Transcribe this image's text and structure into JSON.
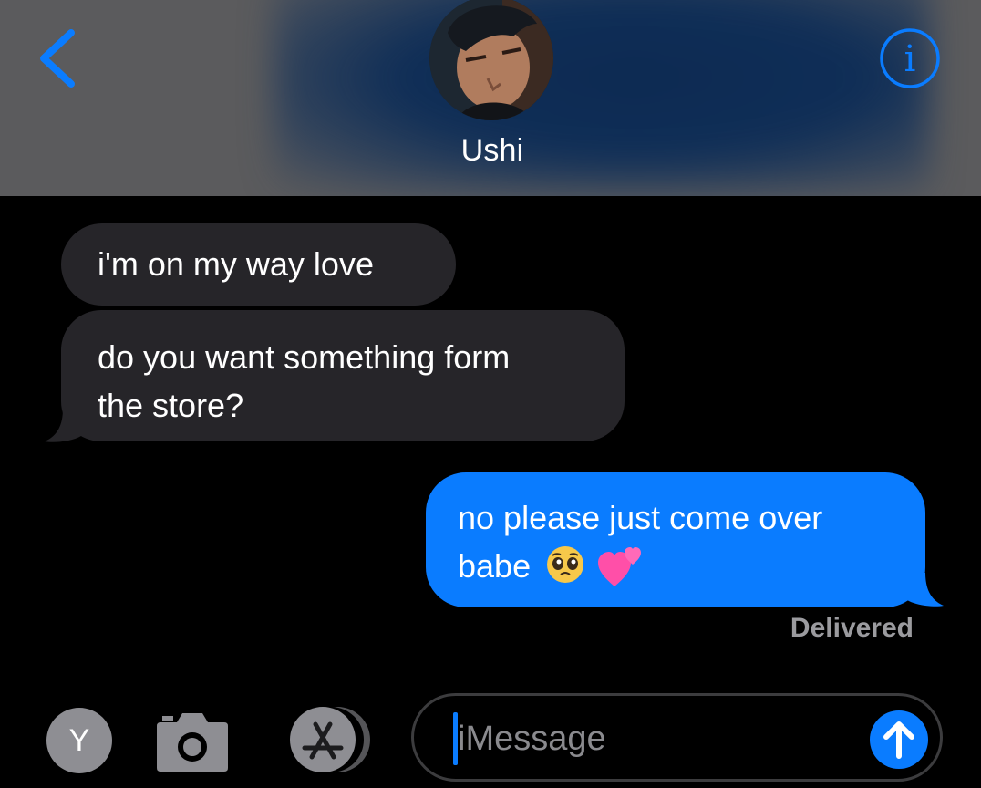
{
  "header": {
    "contact_name": "Ushi",
    "back_icon": "chevron-left-icon",
    "info_icon": "info-icon"
  },
  "messages": [
    {
      "direction": "incoming",
      "lines": [
        "i'm on my way love"
      ]
    },
    {
      "direction": "incoming",
      "lines": [
        "do you want something form",
        "the store?"
      ]
    },
    {
      "direction": "outgoing",
      "lines": [
        "no please just come over",
        "babe"
      ],
      "emoji": [
        "pleading-face",
        "two-hearts"
      ]
    }
  ],
  "status": {
    "delivered": "Delivered"
  },
  "input_bar": {
    "avatar_initial": "Y",
    "placeholder": "iMessage",
    "camera_icon": "camera-icon",
    "apps_icon": "app-store-icon",
    "send_icon": "arrow-up-icon"
  },
  "colors": {
    "accent": "#0a7cff",
    "incoming_bubble": "#262529",
    "header_bg": "#5b5b5d",
    "background": "#000000"
  }
}
